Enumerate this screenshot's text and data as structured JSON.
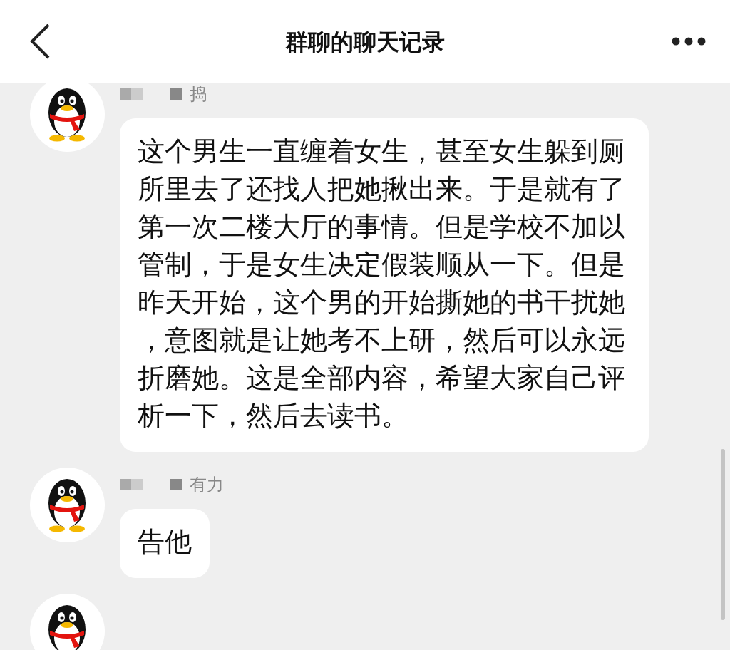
{
  "header": {
    "title": "群聊的聊天记录"
  },
  "messages": [
    {
      "kind": "text",
      "sender": "捣",
      "text": "这个男生一直缠着女生，甚至女生躲到厕所里去了还找人把她揪出来。于是就有了第一次二楼大厅的事情。但是学校不加以管制，于是女生决定假装顺从一下。但是昨天开始，这个男的开始撕她的书干扰她，意图就是让她考不上研，然后可以永远折磨她。这是全部内容，希望大家自己评析一下，然后去读书。"
    },
    {
      "kind": "text",
      "sender": "有力",
      "text": "告他"
    },
    {
      "kind": "avatar_only"
    }
  ]
}
